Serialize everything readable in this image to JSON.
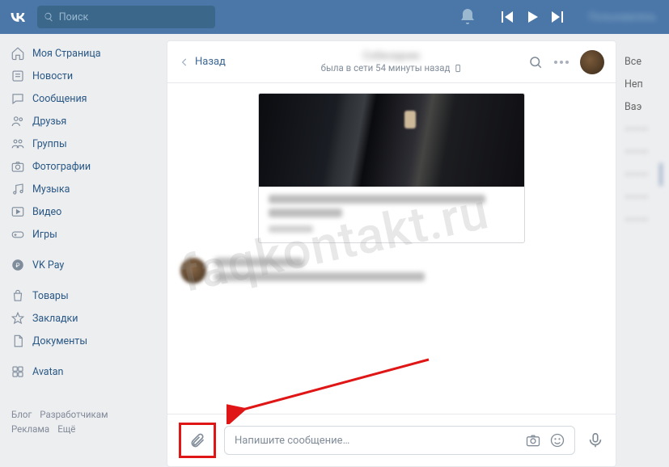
{
  "header": {
    "search_placeholder": "Поиск",
    "username": "Пользователь"
  },
  "sidebar": {
    "items": [
      {
        "label": "Моя Страница"
      },
      {
        "label": "Новости"
      },
      {
        "label": "Сообщения"
      },
      {
        "label": "Друзья"
      },
      {
        "label": "Группы"
      },
      {
        "label": "Фотографии"
      },
      {
        "label": "Музыка"
      },
      {
        "label": "Видео"
      },
      {
        "label": "Игры"
      }
    ],
    "vkpay": "VK Pay",
    "extra": [
      {
        "label": "Товары"
      },
      {
        "label": "Закладки"
      },
      {
        "label": "Документы"
      }
    ],
    "avatan": "Avatan"
  },
  "footer": {
    "blog": "Блог",
    "devs": "Разработчикам",
    "ads": "Реклама",
    "more": "Ещё"
  },
  "chat": {
    "back": "Назад",
    "title": "Собеседник",
    "status": "была в сети 54 минуты назад",
    "input_placeholder": "Напишите сообщение…"
  },
  "rightcol": {
    "all": "Все",
    "unread": "Неп",
    "important": "Ваэ"
  },
  "watermark": "faqkontakt.ru"
}
